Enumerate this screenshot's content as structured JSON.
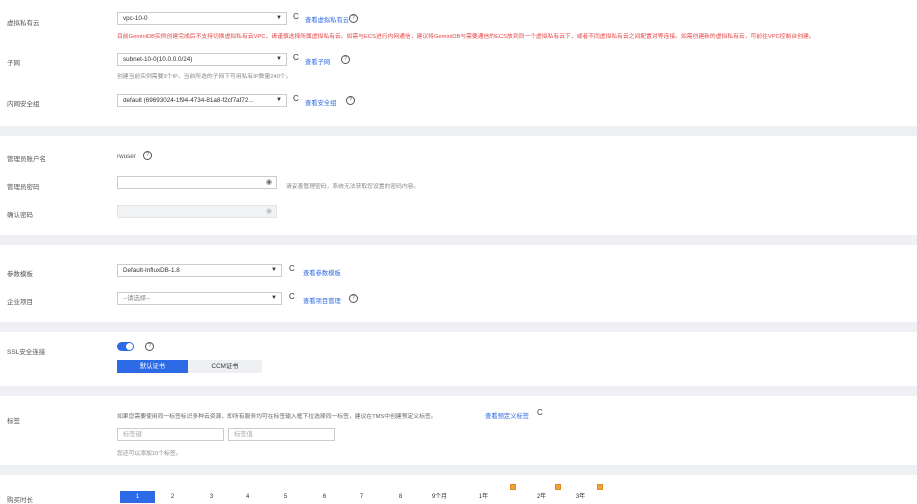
{
  "vpc": {
    "label": "虚拟私有云",
    "value": "vpc-10-0",
    "view_link": "查看虚拟私有云",
    "warning": "目前GeminiDB实例创建完成后不支持切换虚拟私有云VPC，请谨慎选择所属虚拟私有云。如需与ECS进行内网通信，建议将GeminiDB与需要通信的ECS放到同一个虚拟私有云下，或者不同虚拟私有云之间配置对等连接。如需创建新的虚拟私有云，可前往VPC控制台创建。"
  },
  "subnet": {
    "label": "子网",
    "value": "subnet-10-0(10.0.0.0/24)",
    "view_link": "查看子网",
    "hint": "创建当前实例需要3个IP，当前所选的子网下可用私有IP数量240个。"
  },
  "security_group": {
    "label": "内网安全组",
    "value": "default (69693024-1f94-4734-81a8-f2cf7af72...",
    "view_link": "查看安全组"
  },
  "admin": {
    "account_label": "管理员账户名",
    "account_value": "rwuser",
    "password_label": "管理员密码",
    "password_hint": "请妥善管理密码，系统无法获取您设置的密码内容。",
    "confirm_label": "确认密码"
  },
  "param_template": {
    "label": "参数模板",
    "value": "Default-InfluxDB-1.8",
    "view_link": "查看参数模板"
  },
  "enterprise_project": {
    "label": "企业项目",
    "value": "--请选择--",
    "view_link": "查看项目管理"
  },
  "ssl": {
    "label": "SSL安全连接",
    "enabled": true,
    "cert_default": "默认证书",
    "cert_ccm": "CCM证书"
  },
  "tags": {
    "label": "标签",
    "description": "如果您需要使用同一标签标识多种云资源，即所有服务均可在标签输入框下拉选择同一标签，建议在TMS中创建预定义标签。",
    "view_link": "查看预定义标签",
    "key_placeholder": "标签键",
    "value_placeholder": "标签值",
    "limit_hint": "您还可以添加10个标签。"
  },
  "purchase": {
    "label": "购买时长",
    "options": [
      "1",
      "2",
      "3",
      "4",
      "5",
      "6",
      "7",
      "8",
      "9个月",
      "1年",
      "2年",
      "3年"
    ],
    "selected": "1"
  },
  "colors": {
    "accent": "#2d6ae6",
    "warning": "#e54545",
    "band": "#eef0f4"
  },
  "icons": {
    "refresh": "refresh-icon",
    "help": "help-icon",
    "eye": "eye-hidden-icon",
    "discount": "discount-badge-icon"
  }
}
